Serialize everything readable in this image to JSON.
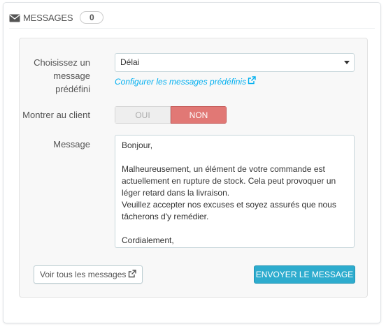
{
  "header": {
    "icon": "envelope-icon",
    "title": "MESSAGES",
    "count": "0"
  },
  "form": {
    "predefined_label": [
      "Choisissez un",
      "message",
      "prédéfini"
    ],
    "predefined_selected": "Délai",
    "configure_link": "Configurer les messages prédéfinis",
    "show_client_label": "Montrer au client",
    "toggle_yes": "OUI",
    "toggle_no": "NON",
    "toggle_selected": "NON",
    "message_label": "Message",
    "message_value": "Bonjour,\n\nMalheureusement, un élément de votre commande est actuellement en rupture de stock. Cela peut provoquer un léger retard dans la livraison.\nVeuillez accepter nos excuses et soyez assurés que nous tâcherons d'y remédier.\n\nCordialement,"
  },
  "buttons": {
    "view_all": "Voir tous les messages",
    "send": "ENVOYER LE MESSAGE"
  },
  "colors": {
    "link": "#00aff0",
    "toggle_no_active": "#e17875",
    "send_button": "#2eacce"
  }
}
